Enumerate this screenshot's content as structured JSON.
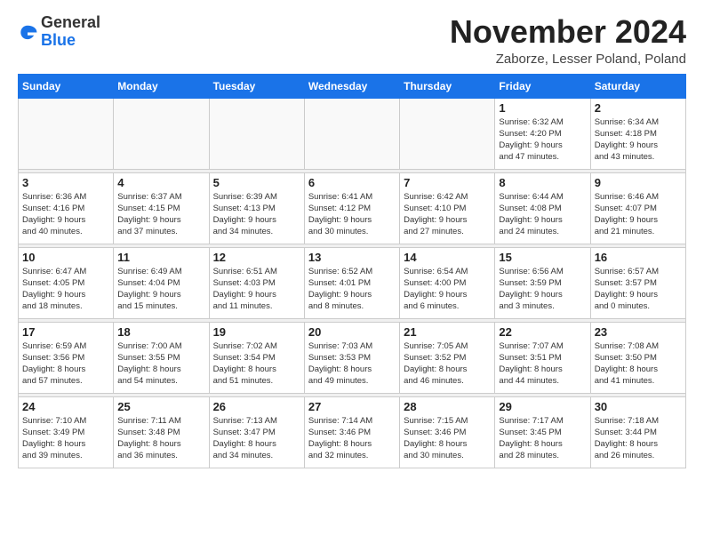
{
  "header": {
    "logo_general": "General",
    "logo_blue": "Blue",
    "month_title": "November 2024",
    "location": "Zaborze, Lesser Poland, Poland"
  },
  "columns": [
    "Sunday",
    "Monday",
    "Tuesday",
    "Wednesday",
    "Thursday",
    "Friday",
    "Saturday"
  ],
  "weeks": [
    [
      {
        "day": "",
        "info": ""
      },
      {
        "day": "",
        "info": ""
      },
      {
        "day": "",
        "info": ""
      },
      {
        "day": "",
        "info": ""
      },
      {
        "day": "",
        "info": ""
      },
      {
        "day": "1",
        "info": "Sunrise: 6:32 AM\nSunset: 4:20 PM\nDaylight: 9 hours\nand 47 minutes."
      },
      {
        "day": "2",
        "info": "Sunrise: 6:34 AM\nSunset: 4:18 PM\nDaylight: 9 hours\nand 43 minutes."
      }
    ],
    [
      {
        "day": "3",
        "info": "Sunrise: 6:36 AM\nSunset: 4:16 PM\nDaylight: 9 hours\nand 40 minutes."
      },
      {
        "day": "4",
        "info": "Sunrise: 6:37 AM\nSunset: 4:15 PM\nDaylight: 9 hours\nand 37 minutes."
      },
      {
        "day": "5",
        "info": "Sunrise: 6:39 AM\nSunset: 4:13 PM\nDaylight: 9 hours\nand 34 minutes."
      },
      {
        "day": "6",
        "info": "Sunrise: 6:41 AM\nSunset: 4:12 PM\nDaylight: 9 hours\nand 30 minutes."
      },
      {
        "day": "7",
        "info": "Sunrise: 6:42 AM\nSunset: 4:10 PM\nDaylight: 9 hours\nand 27 minutes."
      },
      {
        "day": "8",
        "info": "Sunrise: 6:44 AM\nSunset: 4:08 PM\nDaylight: 9 hours\nand 24 minutes."
      },
      {
        "day": "9",
        "info": "Sunrise: 6:46 AM\nSunset: 4:07 PM\nDaylight: 9 hours\nand 21 minutes."
      }
    ],
    [
      {
        "day": "10",
        "info": "Sunrise: 6:47 AM\nSunset: 4:05 PM\nDaylight: 9 hours\nand 18 minutes."
      },
      {
        "day": "11",
        "info": "Sunrise: 6:49 AM\nSunset: 4:04 PM\nDaylight: 9 hours\nand 15 minutes."
      },
      {
        "day": "12",
        "info": "Sunrise: 6:51 AM\nSunset: 4:03 PM\nDaylight: 9 hours\nand 11 minutes."
      },
      {
        "day": "13",
        "info": "Sunrise: 6:52 AM\nSunset: 4:01 PM\nDaylight: 9 hours\nand 8 minutes."
      },
      {
        "day": "14",
        "info": "Sunrise: 6:54 AM\nSunset: 4:00 PM\nDaylight: 9 hours\nand 6 minutes."
      },
      {
        "day": "15",
        "info": "Sunrise: 6:56 AM\nSunset: 3:59 PM\nDaylight: 9 hours\nand 3 minutes."
      },
      {
        "day": "16",
        "info": "Sunrise: 6:57 AM\nSunset: 3:57 PM\nDaylight: 9 hours\nand 0 minutes."
      }
    ],
    [
      {
        "day": "17",
        "info": "Sunrise: 6:59 AM\nSunset: 3:56 PM\nDaylight: 8 hours\nand 57 minutes."
      },
      {
        "day": "18",
        "info": "Sunrise: 7:00 AM\nSunset: 3:55 PM\nDaylight: 8 hours\nand 54 minutes."
      },
      {
        "day": "19",
        "info": "Sunrise: 7:02 AM\nSunset: 3:54 PM\nDaylight: 8 hours\nand 51 minutes."
      },
      {
        "day": "20",
        "info": "Sunrise: 7:03 AM\nSunset: 3:53 PM\nDaylight: 8 hours\nand 49 minutes."
      },
      {
        "day": "21",
        "info": "Sunrise: 7:05 AM\nSunset: 3:52 PM\nDaylight: 8 hours\nand 46 minutes."
      },
      {
        "day": "22",
        "info": "Sunrise: 7:07 AM\nSunset: 3:51 PM\nDaylight: 8 hours\nand 44 minutes."
      },
      {
        "day": "23",
        "info": "Sunrise: 7:08 AM\nSunset: 3:50 PM\nDaylight: 8 hours\nand 41 minutes."
      }
    ],
    [
      {
        "day": "24",
        "info": "Sunrise: 7:10 AM\nSunset: 3:49 PM\nDaylight: 8 hours\nand 39 minutes."
      },
      {
        "day": "25",
        "info": "Sunrise: 7:11 AM\nSunset: 3:48 PM\nDaylight: 8 hours\nand 36 minutes."
      },
      {
        "day": "26",
        "info": "Sunrise: 7:13 AM\nSunset: 3:47 PM\nDaylight: 8 hours\nand 34 minutes."
      },
      {
        "day": "27",
        "info": "Sunrise: 7:14 AM\nSunset: 3:46 PM\nDaylight: 8 hours\nand 32 minutes."
      },
      {
        "day": "28",
        "info": "Sunrise: 7:15 AM\nSunset: 3:46 PM\nDaylight: 8 hours\nand 30 minutes."
      },
      {
        "day": "29",
        "info": "Sunrise: 7:17 AM\nSunset: 3:45 PM\nDaylight: 8 hours\nand 28 minutes."
      },
      {
        "day": "30",
        "info": "Sunrise: 7:18 AM\nSunset: 3:44 PM\nDaylight: 8 hours\nand 26 minutes."
      }
    ]
  ]
}
